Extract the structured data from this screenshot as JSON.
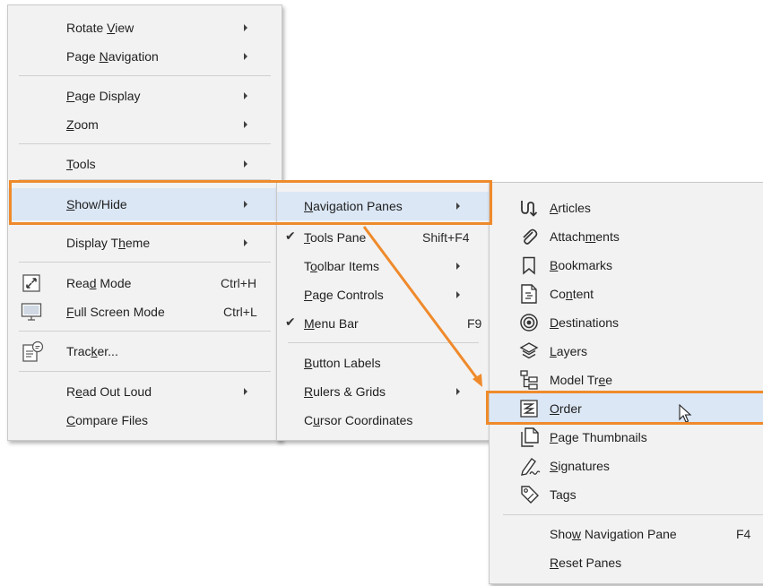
{
  "menu1": {
    "items": [
      {
        "label": "Rotate View",
        "u": 7,
        "arrow": true
      },
      {
        "label": "Page Navigation",
        "u": 5,
        "arrow": true
      },
      {
        "label": "Page Display",
        "u": 0,
        "arrow": true
      },
      {
        "label": "Zoom",
        "u": 0,
        "arrow": true
      },
      {
        "label": "Tools",
        "u": 0,
        "arrow": true
      },
      {
        "label": "Show/Hide",
        "u": 0,
        "arrow": true
      },
      {
        "label": "Display Theme",
        "u": 9,
        "arrow": true
      },
      {
        "label": "Read Mode",
        "u": 3,
        "shortcut": "Ctrl+H",
        "icon": "read-mode-icon"
      },
      {
        "label": "Full Screen Mode",
        "u": 0,
        "shortcut": "Ctrl+L",
        "icon": "full-screen-icon"
      },
      {
        "label": "Tracker...",
        "u": 4,
        "icon": "tracker-icon"
      },
      {
        "label": "Read Out Loud",
        "u": 1,
        "arrow": true
      },
      {
        "label": "Compare Files",
        "u": 0
      }
    ]
  },
  "menu2": {
    "items": [
      {
        "label": "Navigation Panes",
        "u": 0,
        "arrow": true
      },
      {
        "label": "Tools Pane",
        "u": 0,
        "shortcut": "Shift+F4",
        "checked": true
      },
      {
        "label": "Toolbar Items",
        "u": 1,
        "arrow": true
      },
      {
        "label": "Page Controls",
        "u": 0,
        "arrow": true
      },
      {
        "label": "Menu Bar",
        "u": 0,
        "shortcut": "F9",
        "checked": true
      },
      {
        "label": "Button Labels",
        "u": 0
      },
      {
        "label": "Rulers & Grids",
        "u": 0,
        "arrow": true
      },
      {
        "label": "Cursor Coordinates",
        "u": 1
      }
    ]
  },
  "menu3": {
    "items": [
      {
        "label": "Articles",
        "u": 0,
        "icon": "articles-icon"
      },
      {
        "label": "Attachments",
        "u": 6,
        "icon": "attachments-icon"
      },
      {
        "label": "Bookmarks",
        "u": 0,
        "icon": "bookmarks-icon"
      },
      {
        "label": "Content",
        "u": 2,
        "icon": "content-icon"
      },
      {
        "label": "Destinations",
        "u": 0,
        "icon": "destinations-icon"
      },
      {
        "label": "Layers",
        "u": 0,
        "icon": "layers-icon"
      },
      {
        "label": "Model Tree",
        "u": 8,
        "icon": "model-tree-icon"
      },
      {
        "label": "Order",
        "u": 0,
        "icon": "order-icon"
      },
      {
        "label": "Page Thumbnails",
        "u": 0,
        "icon": "page-thumbnails-icon"
      },
      {
        "label": "Signatures",
        "u": 0,
        "icon": "signatures-icon"
      },
      {
        "label": "Tags",
        "u": 2,
        "icon": "tags-icon"
      },
      {
        "label": "Show Navigation Pane",
        "u": 3,
        "shortcut": "F4"
      },
      {
        "label": "Reset Panes",
        "u": 0
      }
    ]
  },
  "colors": {
    "highlight": "#dbe7f5",
    "accent": "#ef8a2b",
    "menu_bg": "#f2f2f2"
  }
}
